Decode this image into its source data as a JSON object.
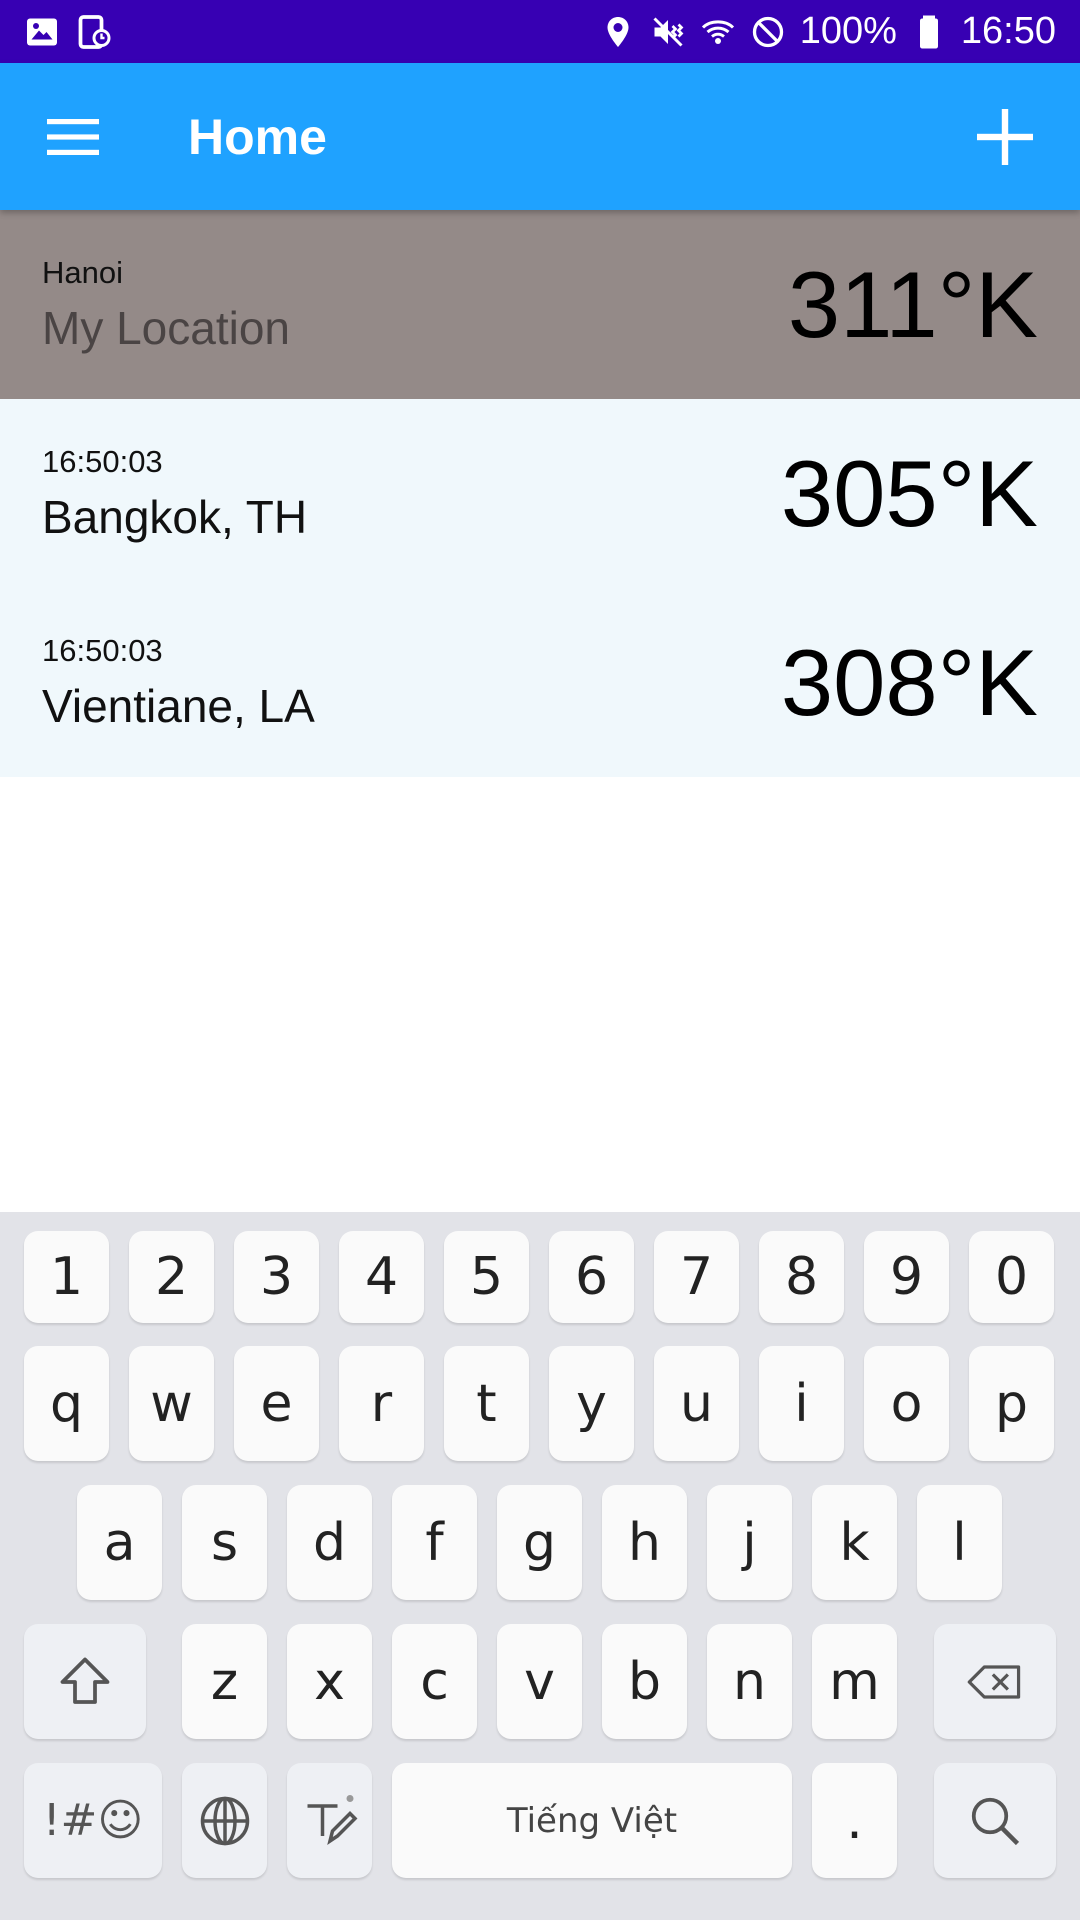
{
  "status_bar": {
    "battery_percent": "100%",
    "time": "16:50",
    "icons": [
      "gallery-icon",
      "screenshot-icon",
      "location-icon",
      "vibrate-mute-icon",
      "wifi-icon",
      "do-not-disturb-icon",
      "battery-icon"
    ]
  },
  "app_bar": {
    "title": "Home",
    "menu_icon": "hamburger-menu-icon",
    "add_icon": "plus-icon"
  },
  "locations": [
    {
      "top_label": "Hanoi",
      "name": "My Location",
      "temperature": "311°K",
      "type": "current"
    },
    {
      "top_label": "16:50:03",
      "name": "Bangkok, TH",
      "temperature": "305°K",
      "type": "city"
    },
    {
      "top_label": "16:50:03",
      "name": "Vientiane, LA",
      "temperature": "308°K",
      "type": "city"
    }
  ],
  "keyboard": {
    "row_numbers": [
      "1",
      "2",
      "3",
      "4",
      "5",
      "6",
      "7",
      "8",
      "9",
      "0"
    ],
    "row_1": [
      "q",
      "w",
      "e",
      "r",
      "t",
      "y",
      "u",
      "i",
      "o",
      "p"
    ],
    "row_2": [
      "a",
      "s",
      "d",
      "f",
      "g",
      "h",
      "j",
      "k",
      "l"
    ],
    "row_3": [
      "z",
      "x",
      "c",
      "v",
      "b",
      "n",
      "m"
    ],
    "symbols_label": "!#☺",
    "space_label": "Tiếng Việt",
    "period_label": ".",
    "colors": {
      "background": "#e2e3e8",
      "key": "#fafafa"
    }
  },
  "colors": {
    "status_bar": "#3700b3",
    "app_bar": "#1fa2ff",
    "current_location_row": "#948a88",
    "city_row": "#f0f8fc"
  }
}
